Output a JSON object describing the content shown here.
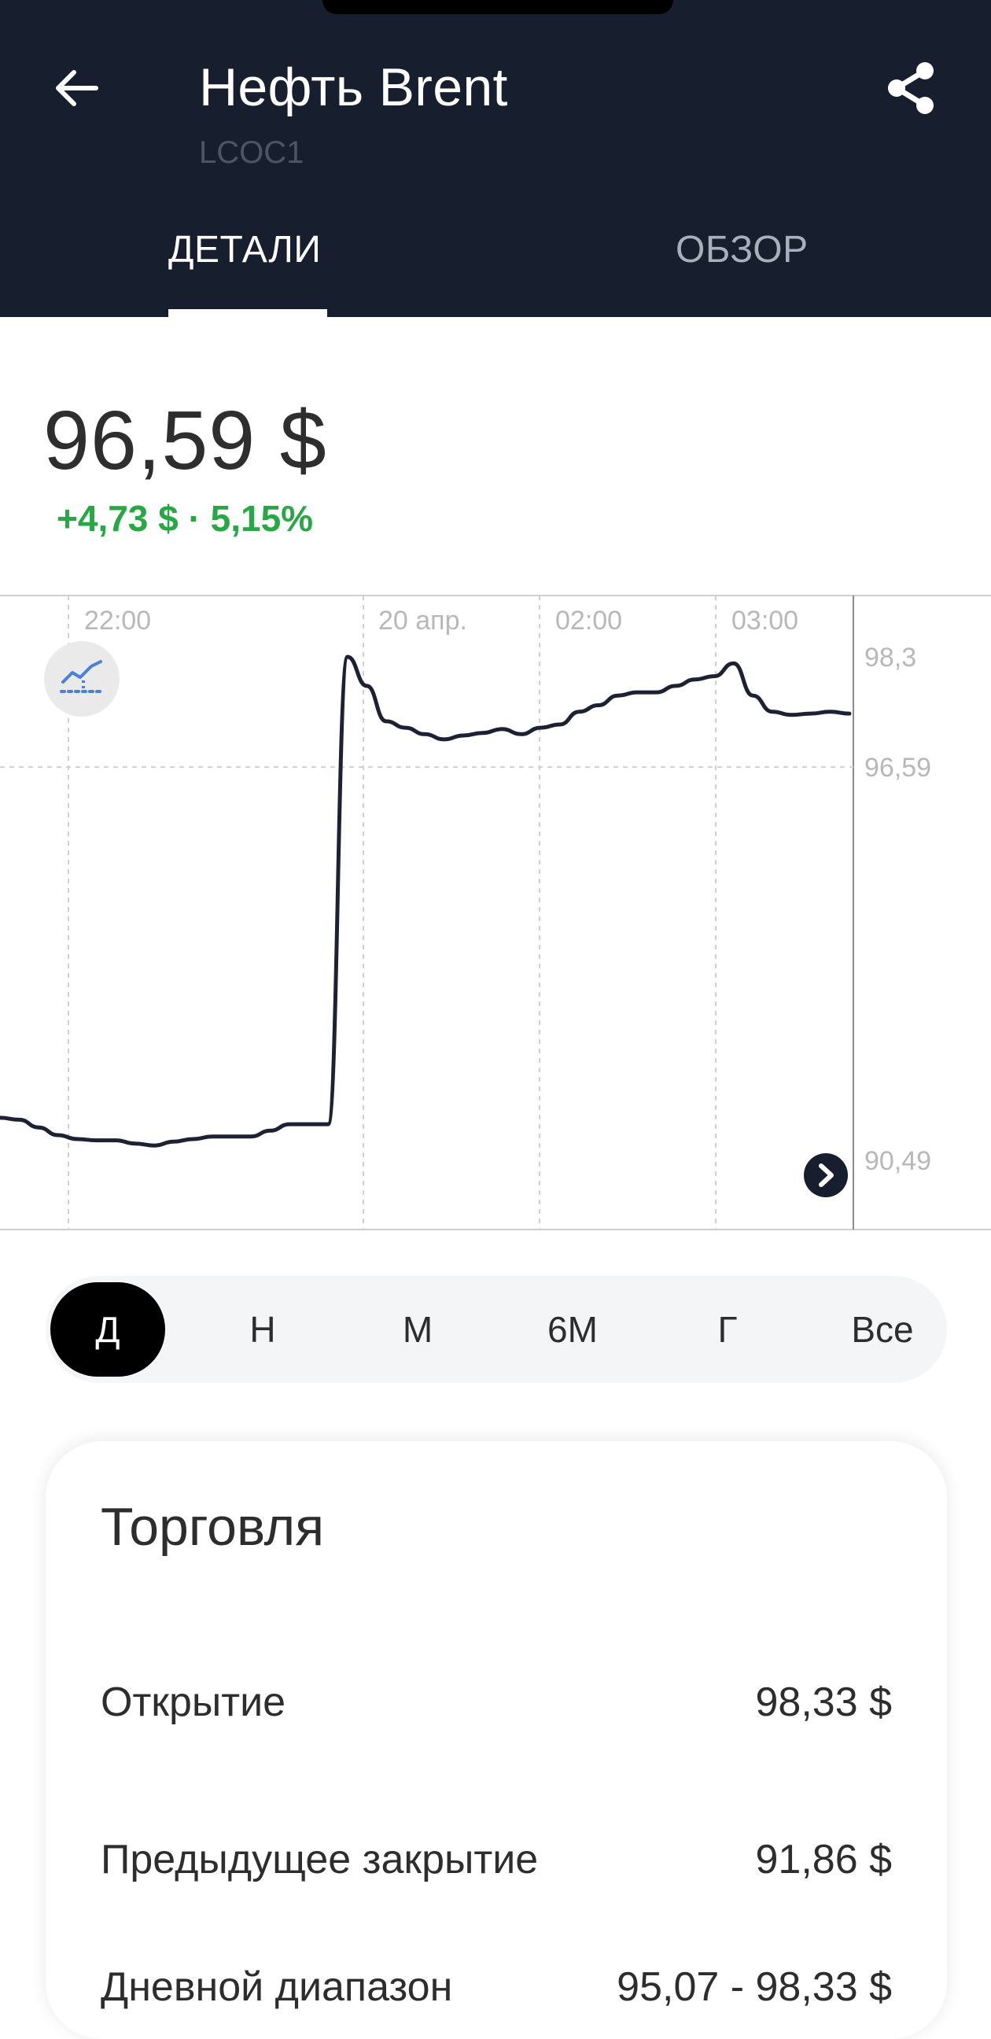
{
  "header": {
    "title": "Нефть Brent",
    "ticker": "LCOC1",
    "tabs": [
      "ДЕТАЛИ",
      "ОБЗОР"
    ],
    "active_tab": "ДЕТАЛИ"
  },
  "quote": {
    "price": "96,59 $",
    "change": "+4,73 $ · 5,15%",
    "change_color": "#27a844"
  },
  "chart_data": {
    "type": "line",
    "x_tick_labels": [
      "22:00",
      "20 апр.",
      "02:00",
      "03:00"
    ],
    "y_tick_labels": [
      "98,3",
      "96,59",
      "90,49"
    ],
    "reference_line": 96.59,
    "ylim": [
      90.49,
      98.3
    ],
    "line_color": "#1c2233",
    "series": [
      {
        "values": [
          91.15,
          91.12,
          91.0,
          90.88,
          90.82,
          90.8,
          90.8,
          90.75,
          90.72,
          90.78,
          90.82,
          90.86,
          90.86,
          90.86,
          90.95,
          91.05,
          91.05,
          91.05,
          98.3,
          97.85,
          97.3,
          97.2,
          97.1,
          97.02,
          97.08,
          97.12,
          97.18,
          97.1,
          97.2,
          97.25,
          97.45,
          97.55,
          97.7,
          97.75,
          97.75,
          97.85,
          97.95,
          98.0,
          98.2,
          97.7,
          97.45,
          97.4,
          97.42,
          97.45,
          97.42
        ]
      }
    ]
  },
  "periods": {
    "options": [
      "Д",
      "Н",
      "М",
      "6М",
      "Г",
      "Все"
    ],
    "selected": "Д"
  },
  "trading": {
    "title": "Торговля",
    "rows": [
      {
        "label": "Открытие",
        "value": "98,33 $"
      },
      {
        "label": "Предыдущее закрытие",
        "value": "91,86 $"
      },
      {
        "label": "Дневной диапазон",
        "value": "95,07 - 98,33 $"
      }
    ]
  },
  "icons": {
    "back": "arrow-left-icon",
    "share": "share-icon",
    "indicator": "chart-indicator-icon",
    "scroll": "chevron-right-icon"
  }
}
